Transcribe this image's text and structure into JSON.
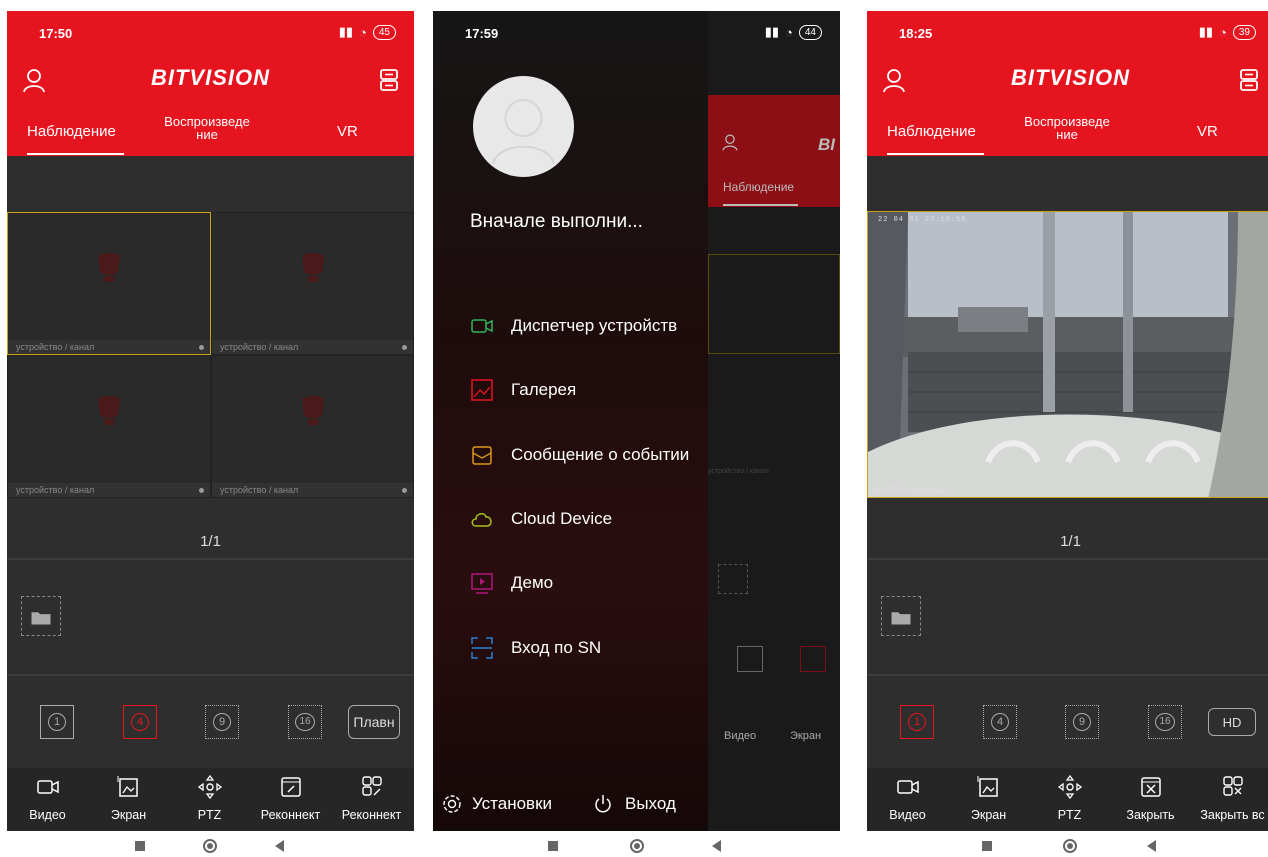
{
  "screen1": {
    "status": {
      "time": "17:50",
      "battery": "45"
    },
    "app_logo": "BITVISION",
    "tabs": [
      {
        "label": "Наблюдение"
      },
      {
        "label": "Воспроизведе\nние"
      },
      {
        "label": "VR"
      }
    ],
    "cells": [
      {
        "label": "устройство / канал"
      },
      {
        "label": "устройство / канал"
      },
      {
        "label": "устройство / канал"
      },
      {
        "label": "устройство / канал"
      }
    ],
    "pager": "1/1",
    "split_controls": {
      "one": "1",
      "four": "4",
      "nine": "9",
      "sixteen": "16",
      "smooth": "Плавн"
    },
    "toolbar": [
      {
        "label": "Видео",
        "icon": "video-icon"
      },
      {
        "label": "Экран",
        "icon": "screen-icon"
      },
      {
        "label": "PTZ",
        "icon": "ptz-icon"
      },
      {
        "label": "Реконнект",
        "icon": "reconnect-icon"
      },
      {
        "label": "Реконнект",
        "icon": "reconnect-all-icon"
      }
    ]
  },
  "screen2": {
    "status": {
      "time": "17:59",
      "battery": "44"
    },
    "drawer_title": "Вначале выполни...",
    "menu": [
      {
        "label": "Диспетчер устройств",
        "icon": "device-manager-icon",
        "color": "#2fb35a"
      },
      {
        "label": "Галерея",
        "icon": "gallery-icon",
        "color": "#e6141f"
      },
      {
        "label": "Сообщение о событии",
        "icon": "event-message-icon",
        "color": "#d99a1a"
      },
      {
        "label": "Cloud Device",
        "icon": "cloud-icon",
        "color": "#a9c21a"
      },
      {
        "label": "Демо",
        "icon": "demo-icon",
        "color": "#b0167a"
      },
      {
        "label": "Вход по SN",
        "icon": "sn-login-icon",
        "color": "#2a7fd4"
      }
    ],
    "settings_label": "Установки",
    "exit_label": "Выход",
    "behind": {
      "tab": "Наблюдение",
      "logo": "BI",
      "video": "Видео",
      "screen": "Экран",
      "cell": "устройство / канал"
    }
  },
  "screen3": {
    "status": {
      "time": "18:25",
      "battery": "39"
    },
    "app_logo": "BITVISION",
    "tabs": [
      {
        "label": "Наблюдение"
      },
      {
        "label": "Воспроизведе\nние"
      },
      {
        "label": "VR"
      }
    ],
    "camera_label": "test,P2P-соединение",
    "camera_timestamp": "22 04 01 23:10:58",
    "pager": "1/1",
    "split_controls": {
      "one": "1",
      "four": "4",
      "nine": "9",
      "sixteen": "16",
      "hd": "HD"
    },
    "toolbar": [
      {
        "label": "Видео",
        "icon": "video-icon"
      },
      {
        "label": "Экран",
        "icon": "screen-icon"
      },
      {
        "label": "PTZ",
        "icon": "ptz-icon"
      },
      {
        "label": "Закрыть",
        "icon": "close-icon"
      },
      {
        "label": "Закрыть вс",
        "icon": "close-all-icon"
      }
    ]
  },
  "colors": {
    "brand_red": "#e6141f",
    "dark_bg": "#2e2e2e",
    "selected_border": "#c9a21a"
  }
}
